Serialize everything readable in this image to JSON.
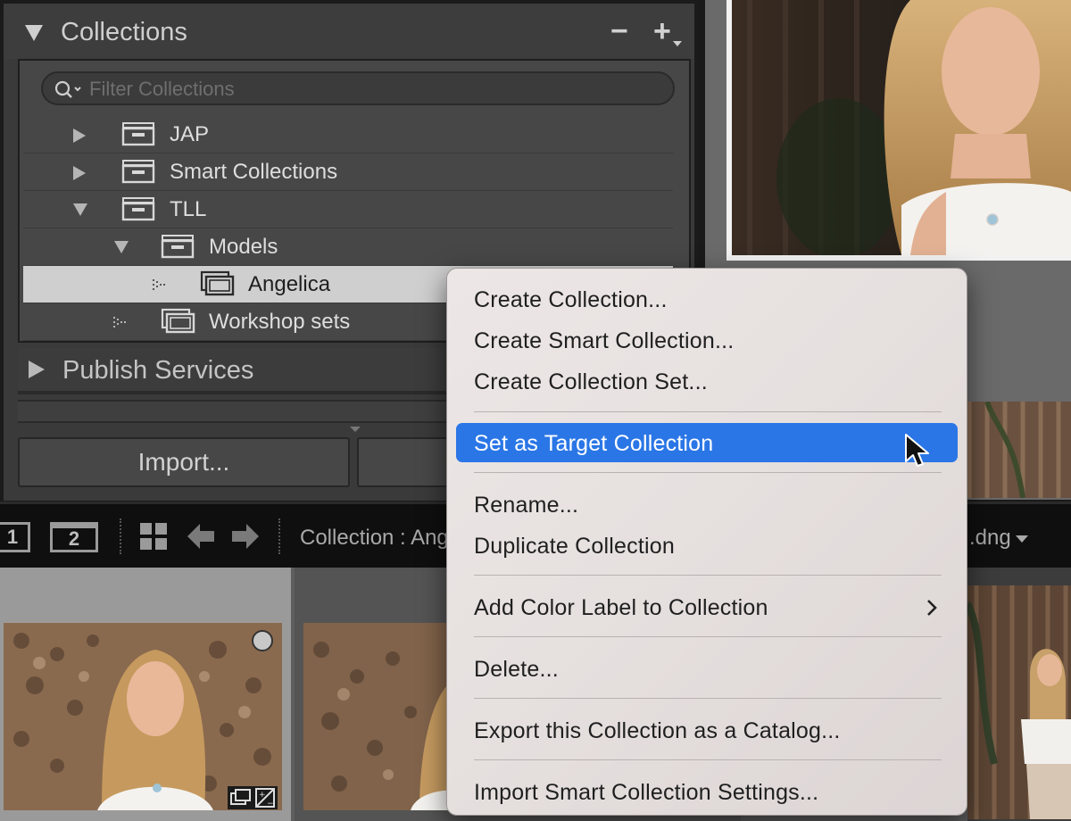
{
  "collections_panel": {
    "title": "Collections",
    "minus_label": "−",
    "plus_label": "+",
    "filter": {
      "placeholder": "Filter Collections",
      "value": ""
    },
    "tree": [
      {
        "label": "JAP",
        "kind": "set",
        "expanded": false
      },
      {
        "label": "Smart Collections",
        "kind": "set",
        "expanded": false
      },
      {
        "label": "TLL",
        "kind": "set",
        "expanded": true
      },
      {
        "label": "Models",
        "kind": "set",
        "expanded": true
      },
      {
        "label": "Angelica",
        "kind": "collection",
        "selected": true
      },
      {
        "label": "Workshop sets",
        "kind": "collection",
        "selected": false
      }
    ]
  },
  "publish_services": {
    "title": "Publish Services"
  },
  "buttons": {
    "import_label": "Import..."
  },
  "toolbar": {
    "view1_label": "1",
    "view2_label": "2",
    "source_text": "Collection : Angelica",
    "filename_text": ".dng"
  },
  "context_menu": {
    "items": [
      {
        "label": "Create Collection..."
      },
      {
        "label": "Create Smart Collection..."
      },
      {
        "label": "Create Collection Set..."
      },
      {
        "label": "Set as Target Collection",
        "highlighted": true
      },
      {
        "label": "Rename..."
      },
      {
        "label": "Duplicate Collection"
      },
      {
        "label": "Add Color Label to Collection",
        "submenu": true
      },
      {
        "label": "Delete..."
      },
      {
        "label": "Export this Collection as a Catalog..."
      },
      {
        "label": "Import Smart Collection Settings..."
      }
    ]
  },
  "colors": {
    "highlight": "#2a76e6",
    "panel_bg": "#3a3a3a",
    "selected_row": "#cfcfcf"
  }
}
